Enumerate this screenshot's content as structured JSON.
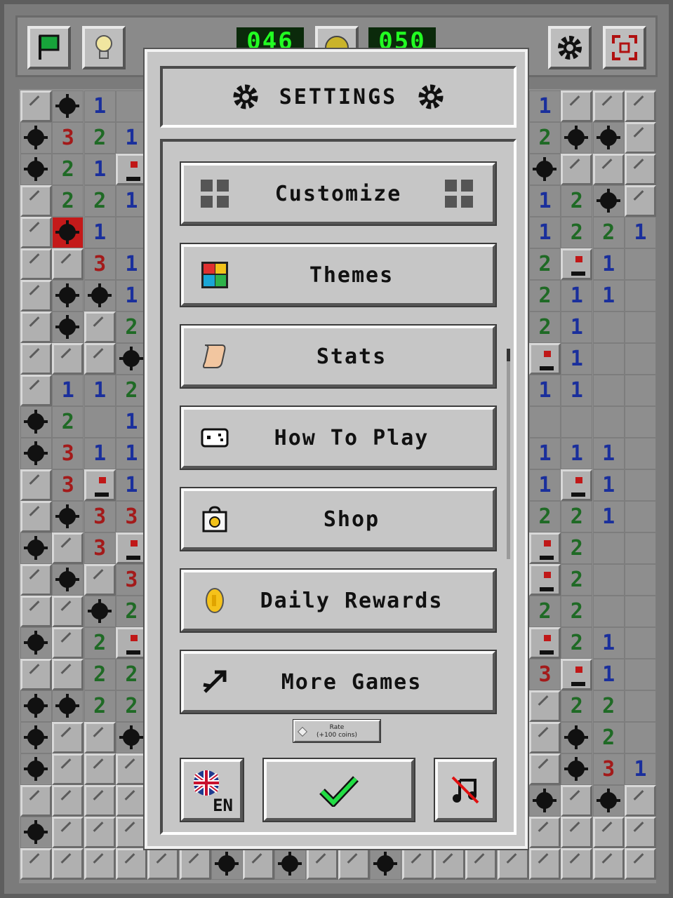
{
  "topbar": {
    "mine_counter": "046",
    "timer": "050"
  },
  "dialog": {
    "title": "SETTINGS",
    "menu": [
      {
        "label": "Customize",
        "icon": "grid-icon"
      },
      {
        "label": "Themes",
        "icon": "palette-icon"
      },
      {
        "label": "Stats",
        "icon": "scroll-icon"
      },
      {
        "label": "How To Play",
        "icon": "controller-icon"
      },
      {
        "label": "Shop",
        "icon": "shopping-bag-icon"
      },
      {
        "label": "Daily Rewards",
        "icon": "coin-icon"
      },
      {
        "label": "More Games",
        "icon": "arrow-icon"
      }
    ],
    "rate": {
      "line1": "Rate",
      "line2": "(+100 coins)"
    },
    "language": "EN",
    "confirm_icon": "checkmark-icon",
    "music_icon": "music-off-icon"
  },
  "colors": {
    "number_1": "#1a2f9c",
    "number_2": "#1f6a25",
    "number_3": "#a31a1a",
    "lcd": "#22ff22",
    "confirm": "#22dd44"
  },
  "board": {
    "left_columns": [
      [
        "r",
        "m",
        "1",
        "o"
      ],
      [
        "m",
        "3",
        "2",
        "1"
      ],
      [
        "m",
        "2",
        "1",
        "f"
      ],
      [
        "r",
        "2",
        "2",
        "1"
      ],
      [
        "r",
        "x",
        "1",
        "o"
      ],
      [
        "r",
        "r",
        "3",
        "1"
      ],
      [
        "r",
        "m",
        "m",
        "1"
      ],
      [
        "r",
        "m",
        "r",
        "2"
      ],
      [
        "r",
        "r",
        "r",
        "m"
      ],
      [
        "r",
        "1",
        "1",
        "2"
      ],
      [
        "m",
        "2",
        "o",
        "1"
      ],
      [
        "m",
        "3",
        "1",
        "1"
      ],
      [
        "r",
        "3",
        "f",
        "1"
      ],
      [
        "r",
        "m",
        "3",
        "3"
      ],
      [
        "m",
        "r",
        "3",
        "f"
      ],
      [
        "r",
        "m",
        "r",
        "3"
      ],
      [
        "r",
        "r",
        "m",
        "2"
      ],
      [
        "m",
        "r",
        "2",
        "f"
      ],
      [
        "r",
        "r",
        "2",
        "2"
      ],
      [
        "m",
        "m",
        "2",
        "2"
      ],
      [
        "m",
        "r",
        "r",
        "m"
      ],
      [
        "m",
        "r",
        "r",
        "r"
      ],
      [
        "r",
        "r",
        "r",
        "r"
      ],
      [
        "m",
        "r",
        "r",
        "r"
      ],
      [
        "r",
        "r",
        "r",
        "r"
      ]
    ],
    "right_columns": [
      [
        "1",
        "r",
        "r",
        "r"
      ],
      [
        "2",
        "m",
        "m",
        "r"
      ],
      [
        "m",
        "r",
        "r",
        "r"
      ],
      [
        "1",
        "2",
        "m",
        "r"
      ],
      [
        "1",
        "2",
        "2",
        "1"
      ],
      [
        "2",
        "f",
        "1",
        "o"
      ],
      [
        "2",
        "1",
        "1",
        "o"
      ],
      [
        "2",
        "1",
        "o",
        "o"
      ],
      [
        "f",
        "1",
        "o",
        "o"
      ],
      [
        "1",
        "1",
        "o",
        "o"
      ],
      [
        "o",
        "o",
        "o",
        "o"
      ],
      [
        "1",
        "1",
        "1",
        "o"
      ],
      [
        "1",
        "f",
        "1",
        "o"
      ],
      [
        "2",
        "2",
        "1",
        "o"
      ],
      [
        "f",
        "2",
        "o",
        "o"
      ],
      [
        "f",
        "2",
        "o",
        "o"
      ],
      [
        "2",
        "2",
        "o",
        "o"
      ],
      [
        "f",
        "2",
        "1",
        "o"
      ],
      [
        "3",
        "f",
        "1",
        "o"
      ],
      [
        "r",
        "2",
        "2",
        "o"
      ],
      [
        "r",
        "m",
        "2",
        "o"
      ],
      [
        "r",
        "m",
        "3",
        "1"
      ],
      [
        "m",
        "r",
        "m",
        "r"
      ],
      [
        "r",
        "r",
        "r",
        "r"
      ],
      [
        "r",
        "r",
        "r",
        "r"
      ]
    ],
    "bottom_row": [
      "r",
      "r",
      "r",
      "r",
      "r",
      "r",
      "m",
      "r",
      "m",
      "r",
      "r",
      "m",
      "r",
      "r",
      "r",
      "r"
    ]
  }
}
